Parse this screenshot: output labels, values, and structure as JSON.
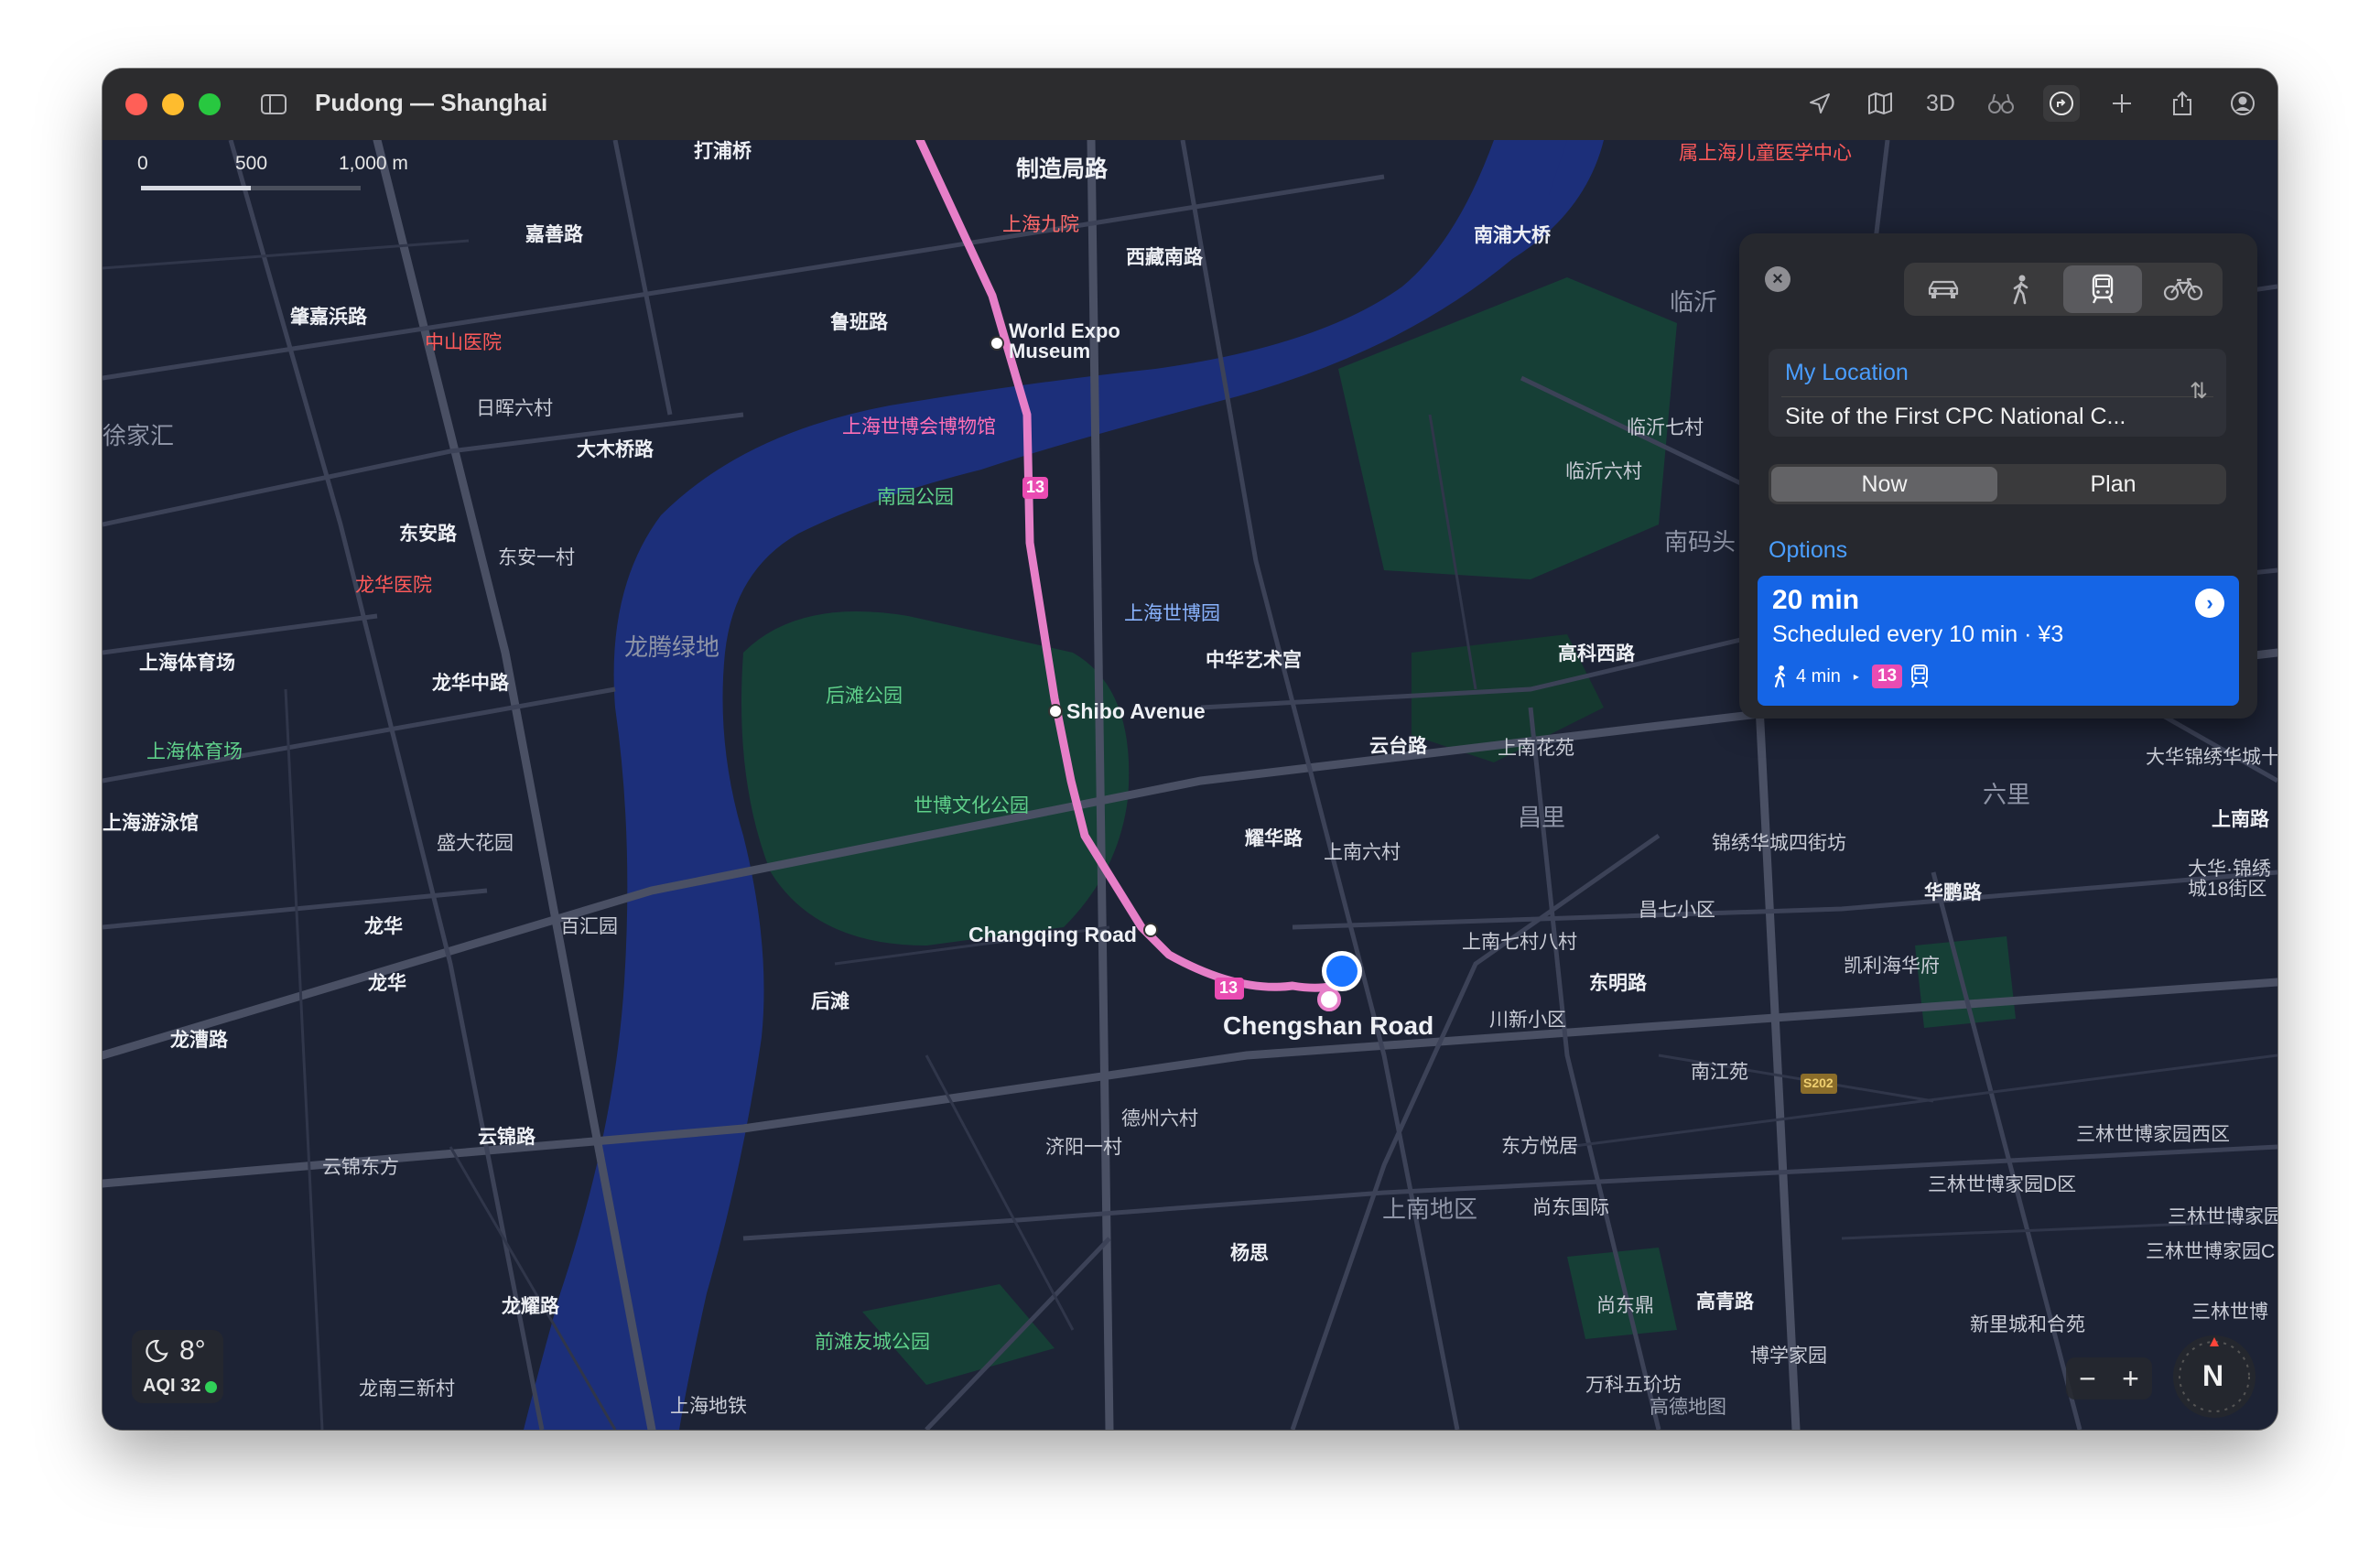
{
  "window": {
    "title": "Pudong — Shanghai"
  },
  "toolbar": {
    "view_3d": "3D"
  },
  "scale": {
    "zero": "0",
    "mid": "500",
    "max": "1,000 m"
  },
  "map_labels": {
    "zhizaoju": "制造局路",
    "jiuyuan": "上海九院",
    "xizang_s": "西藏南路",
    "jiashan": "嘉善路",
    "zhaojiabang": "肇嘉浜路",
    "luban": "鲁班路",
    "zhongshan_hosp": "中山医院",
    "rihui6": "日晖六村",
    "damuqiao": "大木桥路",
    "jiajiahui": "徐家汇",
    "dongan": "东安路",
    "dongan1": "东安一村",
    "longhua_hosp": "龙华医院",
    "tiyuchang1": "上海体育场",
    "longteng": "龙腾绿地",
    "longhuazhong": "龙华中路",
    "tiyuchang2": "上海体育场",
    "youyongguan": "上海游泳馆",
    "shengda": "盛大花园",
    "baihui": "百汇园",
    "longhua1": "龙华",
    "longhua2": "龙华",
    "longcao": "龙漕路",
    "yunjin": "云锦路",
    "yunjindong": "云锦东方",
    "longyao": "龙耀路",
    "longnan3": "龙南三新村",
    "shanghaidi": "上海地铁",
    "houtan": "后滩",
    "houtan_park": "后滩公园",
    "shibowenhua": "世博文化公园",
    "qiantan": "前滩友城公园",
    "world_expo": "World Expo",
    "museum": "Museum",
    "shibo_museum_cn": "上海世博会博物馆",
    "nanyuan": "南园公园",
    "shibo_park": "上海世博园",
    "shibo_ave": "Shibo Avenue",
    "zhonghua_art": "中华艺术宫",
    "changqing": "Changqing Road",
    "chengshan": "Chengshan Road",
    "yaohua": "耀华路",
    "shangnan6": "上南六村",
    "shangnan7": "上南七村八村",
    "chuanxin": "川新小区",
    "dezhou": "德州六村",
    "jiyang": "济阳一村",
    "dongfang_yueju": "东方悦居",
    "shangnan_area": "上南地区",
    "shangguoji": "尚东国际",
    "yangsi": "杨思",
    "shangdongding": "尚东鼎",
    "gaoqing": "高青路",
    "bowang": "博学家园",
    "wanke": "万科五玠坊",
    "nanpu_bridge": "南浦大桥",
    "linyi": "临沂",
    "linyi7": "临沂七村",
    "linyi6": "临沂六村",
    "nanmatou": "南码头",
    "gaoke_w": "高科西路",
    "yuntai": "云台路",
    "shangnan_garden": "上南花苑",
    "changli": "昌里",
    "jinxiu4": "锦绣华城四街坊",
    "changqi": "昌七小区",
    "kaili": "凯利海华府",
    "dongming": "东明路",
    "nanjiangyuan": "南江苑",
    "huapeng": "华鹏路",
    "liuli": "六里",
    "dahua": "大华锦绣华城十",
    "shangnan_rd": "上南路",
    "dahua18": "大华·锦绣",
    "dahua18b": "城18街区",
    "sanlin_w": "三林世博家园西区",
    "sanlin_d": "三林世博家园D区",
    "sanlin_e": "三林世博家园",
    "sanlin_c": "三林世博家园C",
    "xinli": "新里城和合苑",
    "sanlin_x": "三林世博",
    "children_hosp": "属上海儿童医学中心",
    "dapu": "打浦桥",
    "nanpu_label": "临沂",
    "gaode": "高德地图",
    "line13a": "13",
    "line13b": "13",
    "s202": "S202"
  },
  "panel": {
    "from": "My Location",
    "to": "Site of the First CPC National C...",
    "now": "Now",
    "plan": "Plan",
    "options_label": "Options",
    "option": {
      "time": "20 min",
      "detail": "Scheduled every 10 min · ¥3",
      "walk": "4 min",
      "line": "13"
    }
  },
  "weather": {
    "temp": "8°",
    "aqi": "AQI 32"
  },
  "compass": {
    "n": "N"
  },
  "colors": {
    "accent": "#1565e6",
    "metro13": "#e94cb2",
    "location": "#1a73ff",
    "water": "#1c2f7a",
    "park": "#163f36"
  }
}
